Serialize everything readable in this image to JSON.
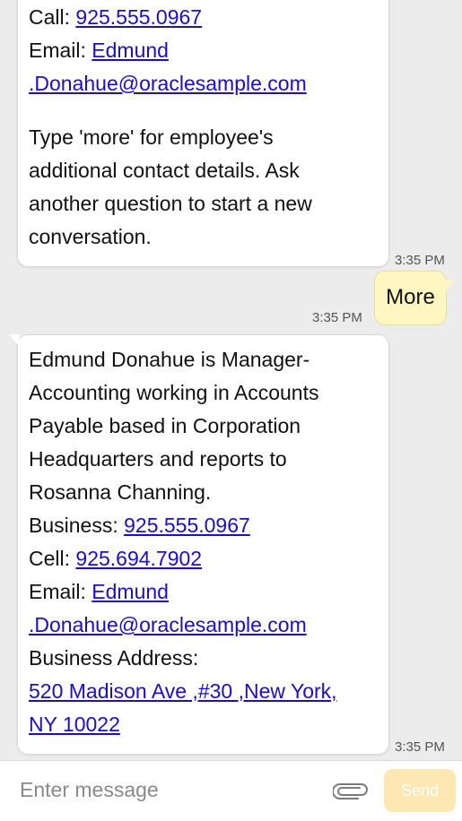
{
  "messages": {
    "bot1": {
      "call_label": "Call: ",
      "call_value": "925.555.0967",
      "email_label": "Email: ",
      "email_part1": "Edmund",
      "email_part2": ".Donahue@oraclesample.com",
      "instruction_lines": [
        "Type 'more' for employee's",
        "additional contact details. Ask",
        "another question to start a new",
        "conversation."
      ],
      "timestamp": "3:35 PM"
    },
    "user": {
      "text": "More",
      "timestamp": "3:35 PM"
    },
    "bot2": {
      "intro_lines": [
        "Edmund Donahue is Manager-",
        "Accounting working in Accounts",
        "Payable based in Corporation",
        "Headquarters and reports to",
        "Rosanna Channing."
      ],
      "business_label": "Business: ",
      "business_value": "925.555.0967",
      "cell_label": "Cell: ",
      "cell_value": "925.694.7902",
      "email_label": "Email: ",
      "email_part1": "Edmund",
      "email_part2": ".Donahue@oraclesample.com",
      "address_label": "Business Address:",
      "address_line1": "520 Madison Ave ,#30 ,New York,",
      "address_line2": "NY 10022",
      "timestamp": "3:35 PM"
    }
  },
  "composer": {
    "placeholder": "Enter message",
    "send_label": "Send",
    "attach_icon": "paperclip-icon"
  },
  "colors": {
    "background": "#ececec",
    "bot_bubble": "#ffffff",
    "user_bubble": "#fff6c2",
    "link": "#1a0dcc",
    "send_button": "#fde8b4"
  }
}
